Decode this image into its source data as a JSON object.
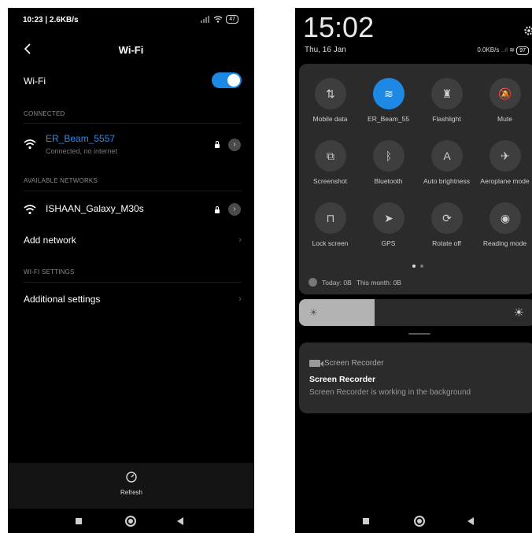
{
  "left": {
    "status": {
      "time": "10:23 | 2.6KB/s",
      "battery": "47"
    },
    "header": {
      "title": "Wi-Fi"
    },
    "wifi_toggle": {
      "label": "Wi-Fi",
      "enabled": true
    },
    "connected": {
      "section_label": "CONNECTED",
      "network": {
        "name": "ER_Beam_5557",
        "status": "Connected, no internet"
      }
    },
    "available": {
      "section_label": "AVAILABLE NETWORKS",
      "networks": [
        {
          "name": "ISHAAN_Galaxy_M30s"
        }
      ]
    },
    "add_network": {
      "label": "Add network"
    },
    "settings_section": {
      "label": "WI-FI SETTINGS"
    },
    "additional_settings": {
      "label": "Additional settings"
    },
    "refresh": {
      "label": "Refresh"
    }
  },
  "right": {
    "time": "15:02",
    "date": "Thu, 16 Jan",
    "net_speed": "0.0KB/s",
    "battery": "97",
    "tiles": [
      {
        "label": "Mobile data",
        "icon": "mobile-data-icon",
        "active": false
      },
      {
        "label": "ER_Beam_55",
        "icon": "wifi-icon",
        "active": true
      },
      {
        "label": "Flashlight",
        "icon": "flashlight-icon",
        "active": false
      },
      {
        "label": "Mute",
        "icon": "mute-icon",
        "active": false
      },
      {
        "label": "Screenshot",
        "icon": "screenshot-icon",
        "active": false
      },
      {
        "label": "Bluetooth",
        "icon": "bluetooth-icon",
        "active": false
      },
      {
        "label": "Auto brightness",
        "icon": "auto-brightness-icon",
        "active": false
      },
      {
        "label": "Aeroplane mode",
        "icon": "aeroplane-icon",
        "active": false
      },
      {
        "label": "Lock screen",
        "icon": "lock-icon",
        "active": false
      },
      {
        "label": "GPS",
        "icon": "gps-icon",
        "active": false
      },
      {
        "label": "Rotate off",
        "icon": "rotate-icon",
        "active": false
      },
      {
        "label": "Reading mode",
        "icon": "reading-mode-icon",
        "active": false
      }
    ],
    "usage": {
      "today": "Today: 0B",
      "month": "This month: 0B"
    },
    "brightness": {
      "level": 0.32
    },
    "notification": {
      "app": "Screen Recorder",
      "title": "Screen Recorder",
      "body": "Screen Recorder is working in the background"
    }
  }
}
